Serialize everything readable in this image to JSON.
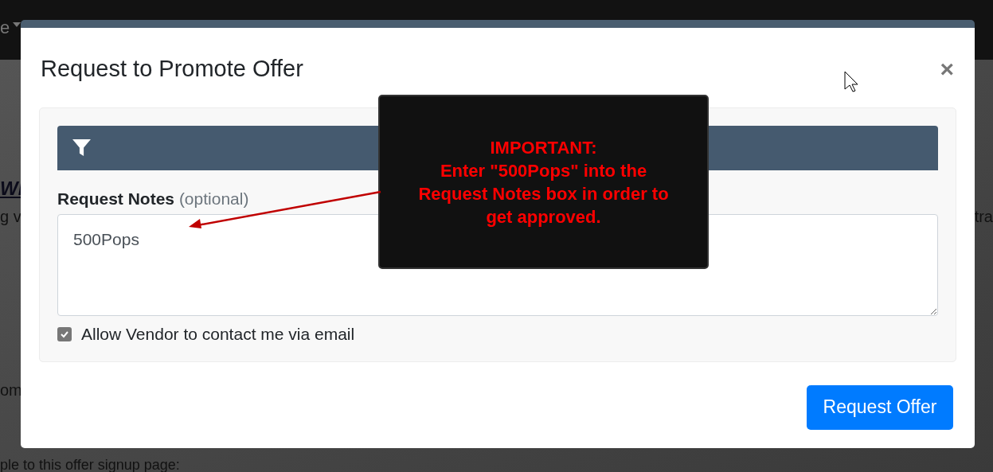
{
  "background": {
    "nav_item": "e",
    "heading": "Wl",
    "line_start": "g v",
    "line_end": "tra",
    "note": "om",
    "footer_text": "ple to this offer signup page:"
  },
  "modal": {
    "title": "Request to Promote Offer",
    "close": "×",
    "notes_label": "Request Notes",
    "notes_hint": "(optional)",
    "notes_value": "500Pops",
    "allow_contact": {
      "label": "Allow Vendor to contact me via email",
      "checked": true
    },
    "submit": "Request Offer"
  },
  "callout": {
    "lines": [
      "IMPORTANT:",
      "Enter \"500Pops\" into the",
      "Request Notes box in order to",
      "get approved."
    ]
  }
}
